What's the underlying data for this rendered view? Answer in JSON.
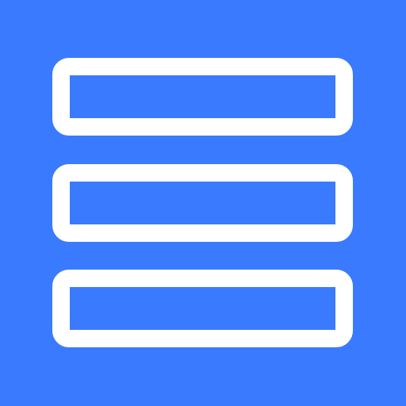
{
  "app_icon": {
    "icon": "menu-icon",
    "background_color": "#3a7afe",
    "stroke_color": "#ffffff",
    "bar_count": 3
  }
}
